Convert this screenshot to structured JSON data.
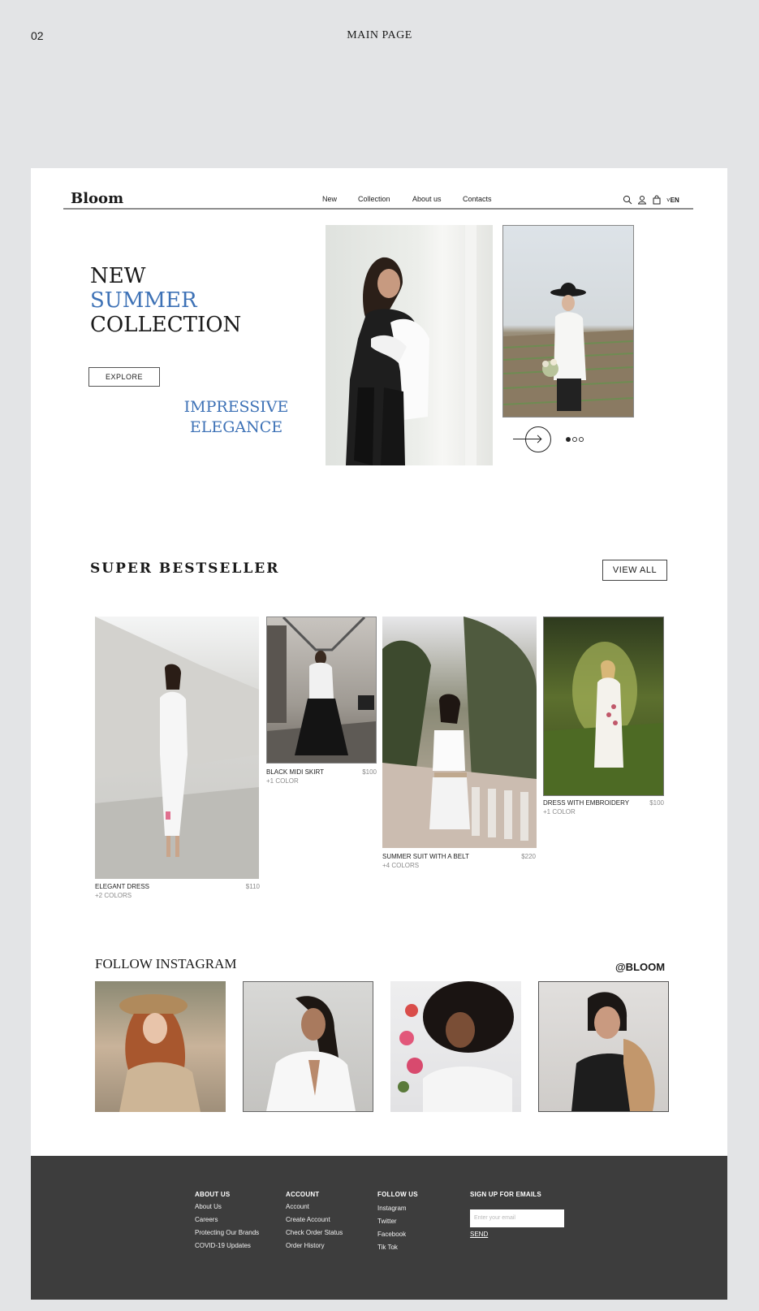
{
  "page": {
    "number": "02",
    "label": "MAIN PAGE"
  },
  "header": {
    "logo": "Bloom",
    "nav": [
      "New",
      "Collection",
      "About us",
      "Contacts"
    ],
    "icons": [
      "search-icon",
      "user-icon",
      "bag-icon"
    ],
    "language": "EN"
  },
  "hero": {
    "title_line1": "NEW",
    "title_line2": "SUMMER",
    "title_line3": "COLLECTION",
    "button": "EXPLORE",
    "tagline_line1": "IMPRESSIVE",
    "tagline_line2": "ELEGANCE",
    "slider_total": 3,
    "slider_active": 1
  },
  "bestseller": {
    "title": "SUPER BESTSELLER",
    "view_all": "VIEW  ALL",
    "products": [
      {
        "name": "ELEGANT DRESS",
        "price": "$110",
        "colors": "+2 COLORS"
      },
      {
        "name": "BLACK MIDI SKIRT",
        "price": "$100",
        "colors": "+1 COLOR"
      },
      {
        "name": "SUMMER SUIT WITH A BELT",
        "price": "$220",
        "colors": "+4 COLORS"
      },
      {
        "name": "DRESS WITH EMBROIDERY",
        "price": "$100",
        "colors": "+1 COLOR"
      }
    ]
  },
  "instagram": {
    "title": "FOLLOW INSTAGRAM",
    "handle": "@BLOOM"
  },
  "footer": {
    "about": {
      "title": "ABOUT US",
      "links": [
        "About Us",
        "Careers",
        "Protecting Our Brands",
        "COVID-19 Updates"
      ]
    },
    "account": {
      "title": "ACCOUNT",
      "links": [
        "Account",
        "Create Account",
        "Check Order Status",
        "Order History"
      ]
    },
    "follow": {
      "title": "FOLLOW US",
      "links": [
        "Instagram",
        "Twitter",
        "Facebook",
        "Tik Tok"
      ]
    },
    "signup": {
      "title": "SIGN UP FOR EMAILS",
      "placeholder": "Enter your email",
      "send": "SEND"
    }
  },
  "colors": {
    "accent": "#3e72b6",
    "footer_bg": "#3d3d3d",
    "page_bg": "#e3e4e6"
  }
}
